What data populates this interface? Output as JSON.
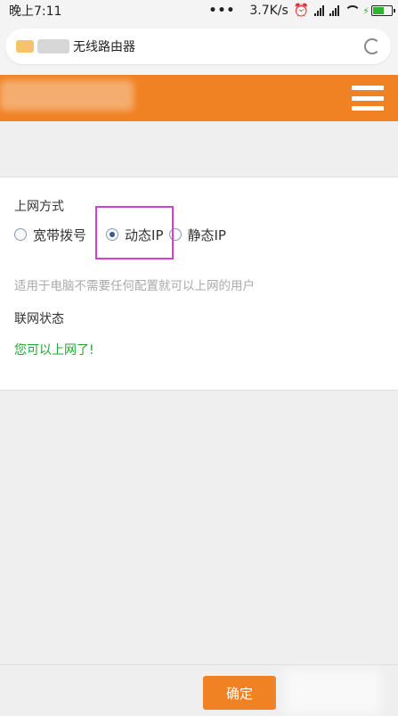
{
  "status_bar": {
    "time": "晚上7:11",
    "dots": "•••",
    "speed": "3.7K/s",
    "icons": [
      "alarm-icon",
      "signal-icon",
      "signal-icon",
      "wifi-icon",
      "battery-icon"
    ]
  },
  "browser": {
    "tab_title": "无线路由器"
  },
  "form": {
    "mode_label": "上网方式",
    "options": [
      {
        "label": "宽带拨号",
        "checked": false
      },
      {
        "label": "动态IP",
        "checked": true
      },
      {
        "label": "静态IP",
        "checked": false
      }
    ],
    "hint": "适用于电脑不需要任何配置就可以上网的用户",
    "status_label": "联网状态",
    "status_text": "您可以上网了!"
  },
  "footer": {
    "confirm_label": "确定"
  },
  "colors": {
    "accent": "#f08223",
    "success": "#22a534",
    "highlight": "#d23fd6"
  }
}
